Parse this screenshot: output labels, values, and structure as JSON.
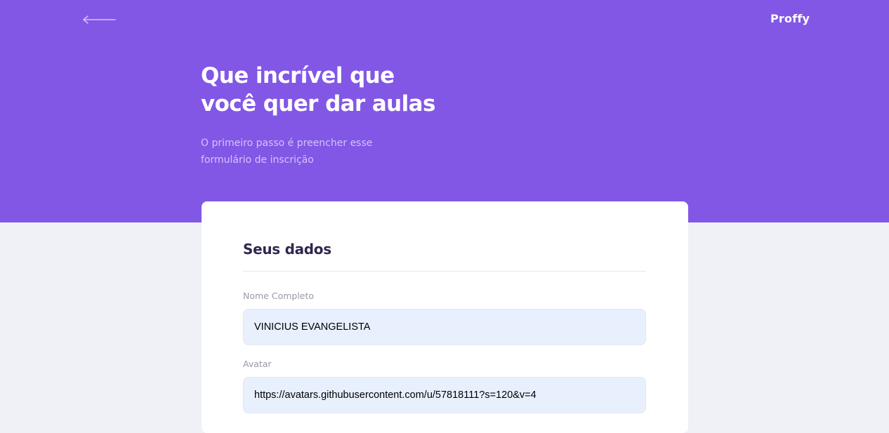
{
  "header": {
    "back_icon": "arrow-left-icon",
    "logo": "Proffy",
    "title_lines": [
      "Que incrível que",
      "você quer dar aulas"
    ],
    "description_lines": [
      "O primeiro passo é preencher esse",
      "formulário de inscrição"
    ],
    "background_color": "#8257E5"
  },
  "form": {
    "legend": "Seus dados",
    "fields": [
      {
        "label": "Nome Completo",
        "value": "VINICIUS EVANGELISTA"
      },
      {
        "label": "Avatar",
        "value": "https://avatars.githubusercontent.com/u/57818111?s=120&v=4"
      }
    ]
  }
}
